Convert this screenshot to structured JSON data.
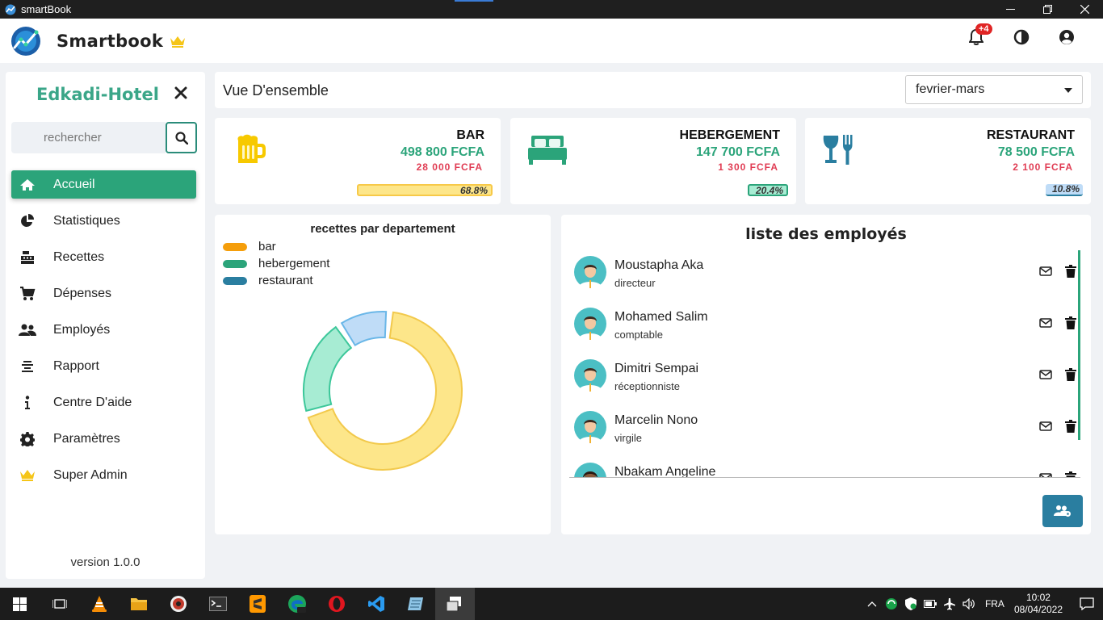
{
  "window": {
    "title": "smartBook"
  },
  "header": {
    "brand": "Smartbook",
    "notifications_badge": "+4"
  },
  "sidebar": {
    "hotel_name": "Edkadi-Hotel",
    "search_placeholder": "rechercher",
    "items": [
      {
        "label": "Accueil",
        "icon": "home-icon",
        "active": true
      },
      {
        "label": "Statistiques",
        "icon": "pie-chart-icon"
      },
      {
        "label": "Recettes",
        "icon": "cash-register-icon"
      },
      {
        "label": "Dépenses",
        "icon": "cart-icon"
      },
      {
        "label": "Employés",
        "icon": "users-icon"
      },
      {
        "label": "Rapport",
        "icon": "report-icon"
      },
      {
        "label": "Centre D'aide",
        "icon": "info-icon"
      },
      {
        "label": "Paramètres",
        "icon": "gear-icon"
      },
      {
        "label": "Super Admin",
        "icon": "crown-icon"
      }
    ],
    "version": "version 1.0.0"
  },
  "overview": {
    "title": "Vue D'ensemble",
    "period": "fevrier-mars"
  },
  "departments": [
    {
      "name": "BAR",
      "revenue": "498 800 FCFA",
      "expense": "28 000 FCFA",
      "percent": "68.8%",
      "progress": 0.688,
      "color": "#f7c948",
      "icon": "beer-mug-icon"
    },
    {
      "name": "HEBERGEMENT",
      "revenue": "147 700 FCFA",
      "expense": "1 300 FCFA",
      "percent": "20.4%",
      "progress": 0.204,
      "color": "#2ba47a",
      "icon": "bed-icon"
    },
    {
      "name": "RESTAURANT",
      "revenue": "78 500 FCFA",
      "expense": "2 100 FCFA",
      "percent": "10.8%",
      "progress": 0.108,
      "color": "#2a7ea0",
      "icon": "wine-fork-icon"
    }
  ],
  "chart_data": {
    "type": "pie",
    "title": "recettes par departement",
    "categories": [
      "bar",
      "hebergement",
      "restaurant"
    ],
    "values": [
      68.8,
      20.4,
      10.8
    ],
    "legend_colors": [
      "#f59e0b",
      "#2ba47a",
      "#2a7ea0"
    ],
    "fill_colors": [
      "#fde68a",
      "#a7ecd3",
      "#bfdcf7"
    ],
    "legend_position": "top-left"
  },
  "employees": {
    "title": "liste des employés",
    "list": [
      {
        "name": "Moustapha Aka",
        "role": "directeur"
      },
      {
        "name": "Mohamed Salim",
        "role": "comptable"
      },
      {
        "name": "Dimitri Sempai",
        "role": "réceptionniste"
      },
      {
        "name": "Marcelin Nono",
        "role": "virgile"
      },
      {
        "name": "Nbakam Angeline",
        "role": ""
      }
    ]
  },
  "taskbar": {
    "language": "FRA",
    "time": "10:02",
    "date": "08/04/2022"
  }
}
